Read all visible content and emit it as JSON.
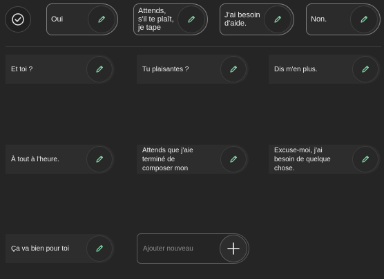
{
  "top_row": {
    "confirm_icon": "check-circle-icon",
    "items": [
      {
        "label": "Oui"
      },
      {
        "label": "Attends,\ns'il te plaît,\nje tape"
      },
      {
        "label": "J'ai besoin\nd'aide."
      },
      {
        "label": "Non."
      }
    ]
  },
  "phrases": [
    {
      "label": "Et toi ?"
    },
    {
      "label": "Tu plaisantes ?"
    },
    {
      "label": "Dis m'en plus."
    },
    {
      "label": "À tout à l'heure."
    },
    {
      "label": "Attends que j'aie\nterminé de\ncomposer mon"
    },
    {
      "label": "Excuse-moi, j'ai\nbesoin de quelque\nchose."
    },
    {
      "label": "Ça va bien pour toi"
    }
  ],
  "add_new": {
    "placeholder": "Ajouter nouveau",
    "icon": "plus-icon"
  },
  "colors": {
    "accent": "#7fd8a8",
    "background": "#252525",
    "card": "#2d2d2d"
  }
}
